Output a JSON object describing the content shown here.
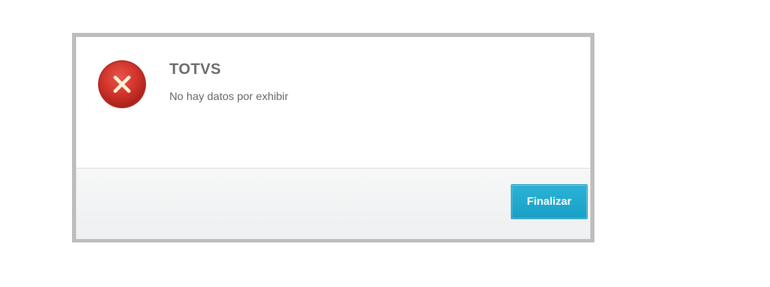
{
  "dialog": {
    "title": "TOTVS",
    "message": "No hay datos por exhibir",
    "icon": "error-x-icon",
    "finalize_label": "Finalizar"
  },
  "colors": {
    "error_red": "#d0332a",
    "button_blue": "#1ea6cd",
    "frame_gray": "#bdbdbd",
    "text_gray": "#6b6b6b"
  }
}
